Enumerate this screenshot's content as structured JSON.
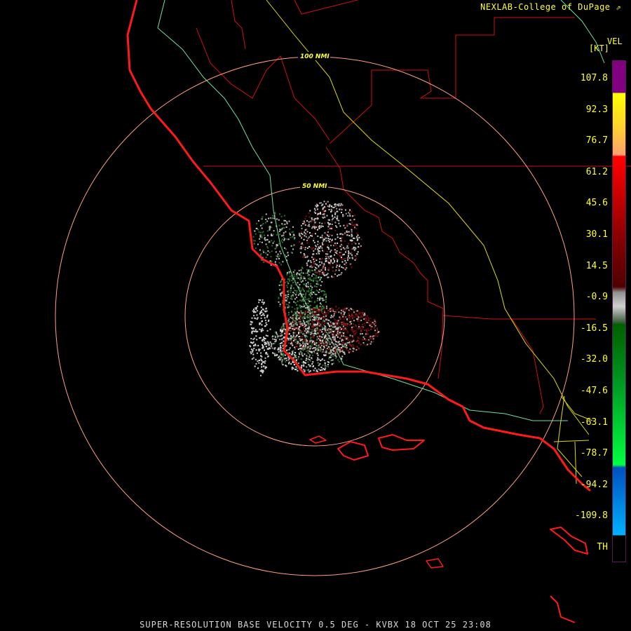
{
  "header": {
    "credit": "NEXLAB-College of DuPage",
    "credit_icon": "external-link-icon"
  },
  "legend": {
    "product": "VEL",
    "unit": "[KT]",
    "ticks": [
      "107.8",
      "92.3",
      "76.7",
      "61.2",
      "45.6",
      "30.1",
      "14.5",
      "-0.9",
      "-16.5",
      "-32.0",
      "-47.6",
      "-63.1",
      "-78.7",
      "-94.2",
      "-109.8",
      "TH"
    ]
  },
  "map": {
    "rings": [
      {
        "label": "100 NMI"
      },
      {
        "label": "50 NMI"
      }
    ],
    "colors": {
      "coast": "#ff1a1a",
      "borders": "#e01010",
      "roads": "#e0e000",
      "rivers": "#70e0a0",
      "rings": "#ffa080"
    }
  },
  "caption": "SUPER-RESOLUTION BASE VELOCITY 0.5 DEG - KVBX 18 OCT 25 23:08"
}
